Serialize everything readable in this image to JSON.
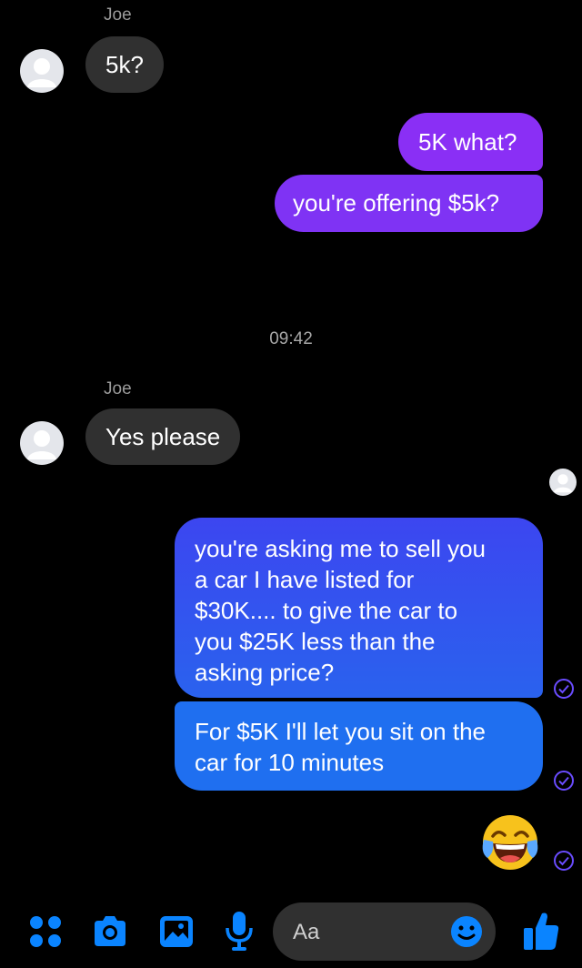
{
  "contact": {
    "name": "Joe"
  },
  "messages": [
    {
      "direction": "incoming",
      "sender": "Joe",
      "text": "5k?"
    },
    {
      "direction": "outgoing",
      "text": "5K what?"
    },
    {
      "direction": "outgoing",
      "text": "you're offering $5k?"
    },
    {
      "timestamp": "09:42"
    },
    {
      "direction": "incoming",
      "sender": "Joe",
      "text": "Yes please"
    },
    {
      "direction": "outgoing",
      "lines": [
        "you're asking me to sell you",
        "a car I have listed for",
        "$30K.... to give the car to",
        "you $25K less than the",
        "asking price?"
      ]
    },
    {
      "direction": "outgoing",
      "lines": [
        "For $5K I'll let you sit on the",
        "car for 10 minutes"
      ]
    },
    {
      "direction": "outgoing",
      "emoji": "😂"
    }
  ],
  "composer": {
    "placeholder": "Aa"
  },
  "icons": {
    "toolbar": [
      "apps-icon",
      "camera-icon",
      "gallery-icon",
      "microphone-icon",
      "emoji-icon",
      "thumbs-up-icon"
    ],
    "read_receipt": "check-circle-icon"
  },
  "colors": {
    "accent": "#0a84ff",
    "incoming_bubble": "#303030",
    "outgoing_purple": "#8b2ff5",
    "outgoing_blue": "#1e6ff0"
  }
}
